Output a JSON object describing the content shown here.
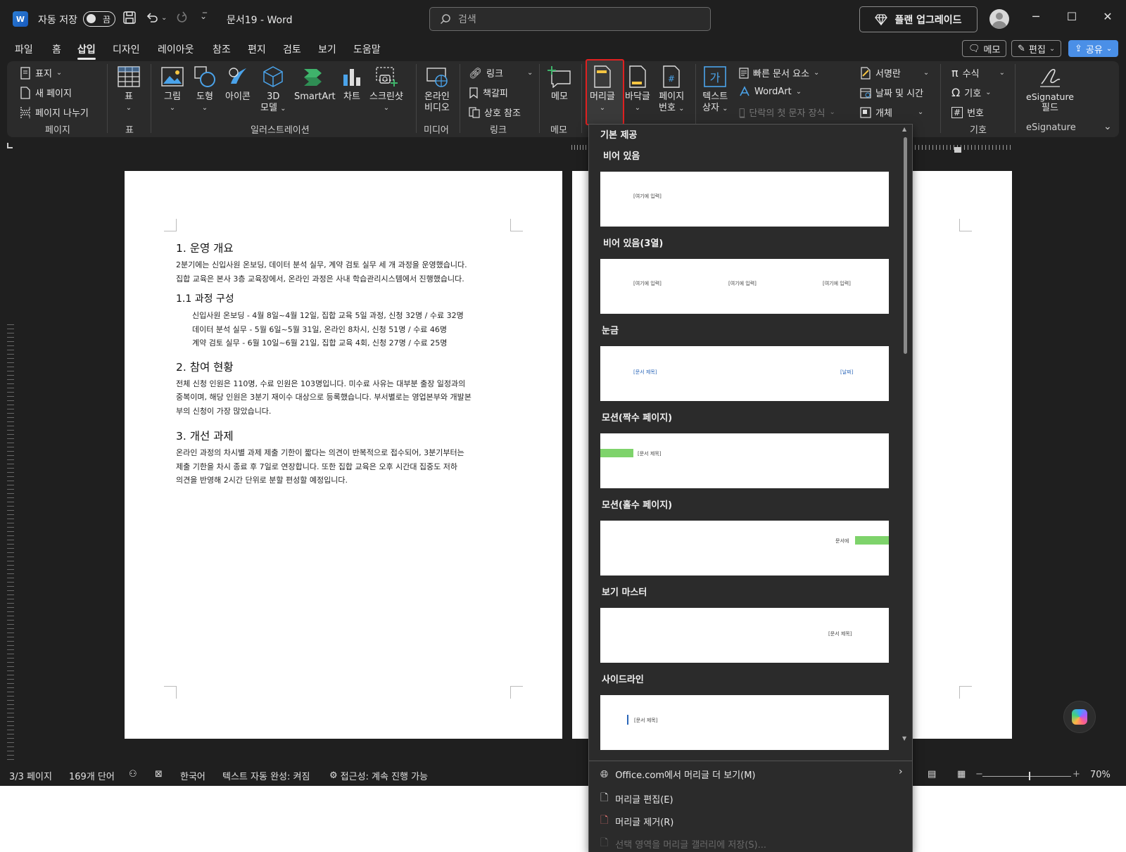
{
  "titlebar": {
    "autosave_label": "자동 저장",
    "autosave_state": "끔",
    "doc_title": "문서19  -  Word",
    "search_placeholder": "검색",
    "upgrade_label": "플랜 업그레이드"
  },
  "tabs": [
    "파일",
    "홈",
    "삽입",
    "디자인",
    "레이아웃",
    "참조",
    "편지",
    "검토",
    "보기",
    "도움말"
  ],
  "active_tab": "삽입",
  "right_buttons": {
    "memo": "메모",
    "edit": "편집",
    "share": "공유"
  },
  "ribbon": {
    "pages_group": {
      "cover": "표지",
      "new_page": "새 페이지",
      "page_break": "페이지 나누기",
      "label": "페이지"
    },
    "table_group": {
      "table": "표",
      "label": "표"
    },
    "illustration_group": {
      "picture": "그림",
      "shapes": "도형",
      "icons": "아이콘",
      "model3d_line1": "3D",
      "model3d_line2": "모델",
      "smartart": "SmartArt",
      "chart": "차트",
      "screenshot": "스크린샷",
      "label": "일러스트레이션"
    },
    "media_group": {
      "online_video_line1": "온라인",
      "online_video_line2": "비디오",
      "label": "미디어"
    },
    "link_group": {
      "link": "링크",
      "bookmark": "책갈피",
      "cross_ref": "상호 참조",
      "label": "링크"
    },
    "comment_group": {
      "memo": "메모",
      "label": "메모"
    },
    "header_footer_group": {
      "header": "머리글",
      "footer": "바닥글",
      "page_number_line1": "페이지",
      "page_number_line2": "번호"
    },
    "text_group": {
      "textbox_line1": "텍스트",
      "textbox_line2": "상자",
      "quick_parts": "빠른 문서 요소",
      "wordart": "WordArt",
      "dropcap": "단락의 첫 문자 장식",
      "signature": "서명란",
      "datetime": "날짜 및 시간",
      "object": "개체"
    },
    "symbol_group": {
      "equation": "수식",
      "symbol": "기호",
      "number": "번호",
      "label": "기호"
    },
    "esign_group": {
      "line1": "eSignature",
      "line2": "필드",
      "label": "eSignature"
    }
  },
  "document": {
    "h1_1": "1. 운영 개요",
    "p1_1": "2분기에는 신입사원 온보딩, 데이터 분석 실무, 계약 검토 실무 세 개 과정을 운영했습니다.",
    "p1_2": "집합 교육은 본사 3층 교육장에서, 온라인 과정은 사내 학습관리시스템에서 진행했습니다.",
    "h2_1": "1.1 과정 구성",
    "list": [
      "신입사원 온보딩 - 4월 8일~4월 12일, 집합 교육 5일 과정, 신청 32명 / 수료 32명",
      "데이터 분석 실무 - 5월 6일~5월 31일, 온라인 8차시, 신청 51명 / 수료 46명",
      "계약 검토 실무 - 6월 10일~6월 21일, 집합 교육 4회, 신청 27명 / 수료 25명"
    ],
    "h1_2": "2. 참여 현황",
    "p2_1": "전체 신청 인원은 110명, 수료 인원은 103명입니다. 미수료 사유는 대부분 출장 일정과의",
    "p2_2": "중복이며, 해당 인원은 3분기 재이수 대상으로 등록했습니다. 부서별로는 영업본부와 개발본",
    "p2_3": "부의 신청이 가장 많았습니다.",
    "h1_3": "3. 개선 과제",
    "p3_1": "온라인 과정의 차시별 과제 제출 기한이 짧다는 의견이 반복적으로 접수되어, 3분기부터는",
    "p3_2": "제출 기한을 차시 종료 후 7일로 연장합니다. 또한 집합 교육은 오후 시간대 집중도 저하",
    "p3_3": "의견을 반영해 2시간 단위로 분할 편성할 예정입니다."
  },
  "header_gallery": {
    "section": "기본 제공",
    "items": [
      {
        "name": "비어 있음",
        "texts": [
          "[여기에 입력]"
        ]
      },
      {
        "name": "비어 있음(3열)",
        "texts": [
          "[여기에 입력]",
          "[여기에 입력]",
          "[여기에 입력]"
        ]
      },
      {
        "name": "눈금",
        "texts": [
          "[문서 제목]",
          "[날짜]"
        ]
      },
      {
        "name": "모션(짝수 페이지)",
        "texts": [
          "[문서 제목]"
        ]
      },
      {
        "name": "모션(홀수 페이지)",
        "texts": [
          "문서에"
        ]
      },
      {
        "name": "보기 마스터",
        "texts": [
          "[문서 제목]"
        ]
      },
      {
        "name": "사이드라인",
        "texts": [
          "[문서 제목]"
        ]
      }
    ],
    "more_office": "Office.com에서 머리글 더 보기(M)",
    "edit_header": "머리글 편집(E)",
    "remove_header": "머리글 제거(R)",
    "save_selection": "선택 영역을 머리글 갤러리에 저장(S)..."
  },
  "statusbar": {
    "page": "3/3 페이지",
    "words": "169개 단어",
    "language": "한국어",
    "autocomplete": "텍스트 자동 완성: 켜짐",
    "accessibility": "접근성: 계속 진행 가능",
    "zoom": "70%"
  },
  "colors": {
    "accent_green": "#7ed36b",
    "highlight_red": "#e02020",
    "share_blue": "#4a8fe7"
  }
}
